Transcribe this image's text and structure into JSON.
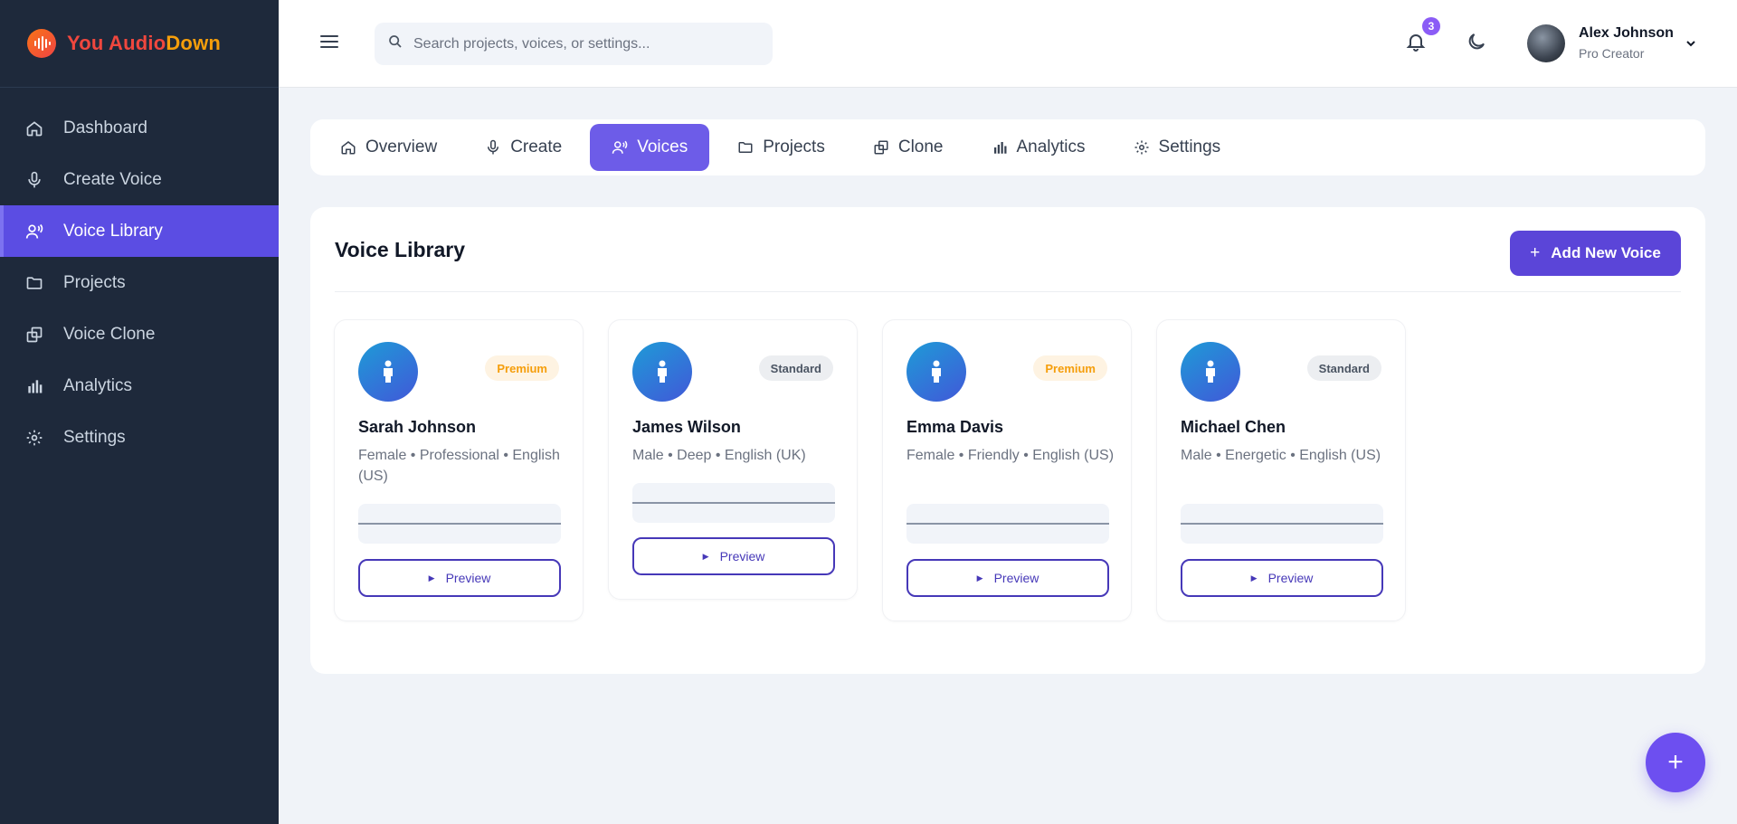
{
  "brand": {
    "part1": "You Audio",
    "part2": "Down"
  },
  "sidebar": {
    "items": [
      {
        "label": "Dashboard",
        "icon": "home-icon"
      },
      {
        "label": "Create Voice",
        "icon": "microphone-icon"
      },
      {
        "label": "Voice Library",
        "icon": "voice-users-icon",
        "active": true
      },
      {
        "label": "Projects",
        "icon": "folder-icon"
      },
      {
        "label": "Voice Clone",
        "icon": "clone-icon"
      },
      {
        "label": "Analytics",
        "icon": "bar-chart-icon"
      },
      {
        "label": "Settings",
        "icon": "gear-icon"
      }
    ]
  },
  "header": {
    "search_placeholder": "Search projects, voices, or settings...",
    "notification_count": "3",
    "user": {
      "name": "Alex Johnson",
      "role": "Pro Creator"
    }
  },
  "tabs": [
    {
      "label": "Overview",
      "icon": "home-icon"
    },
    {
      "label": "Create",
      "icon": "microphone-icon"
    },
    {
      "label": "Voices",
      "icon": "voice-users-icon",
      "active": true
    },
    {
      "label": "Projects",
      "icon": "folder-icon"
    },
    {
      "label": "Clone",
      "icon": "clone-icon"
    },
    {
      "label": "Analytics",
      "icon": "bar-chart-icon"
    },
    {
      "label": "Settings",
      "icon": "gear-icon"
    }
  ],
  "main": {
    "title": "Voice Library",
    "add_button": "Add New Voice",
    "preview_label": "Preview",
    "voices": [
      {
        "name": "Sarah Johnson",
        "desc": "Female • Professional • English (US)",
        "tier": "Premium"
      },
      {
        "name": "James Wilson",
        "desc": "Male • Deep • English (UK)",
        "tier": "Standard"
      },
      {
        "name": "Emma Davis",
        "desc": "Female • Friendly • English (US)",
        "tier": "Premium"
      },
      {
        "name": "Michael Chen",
        "desc": "Male • Energetic • English (US)",
        "tier": "Standard"
      }
    ]
  },
  "fab_label": "+",
  "colors": {
    "sidebar_bg": "#1e293b",
    "accent": "#5b4de3",
    "premium": "#f59e0b"
  }
}
